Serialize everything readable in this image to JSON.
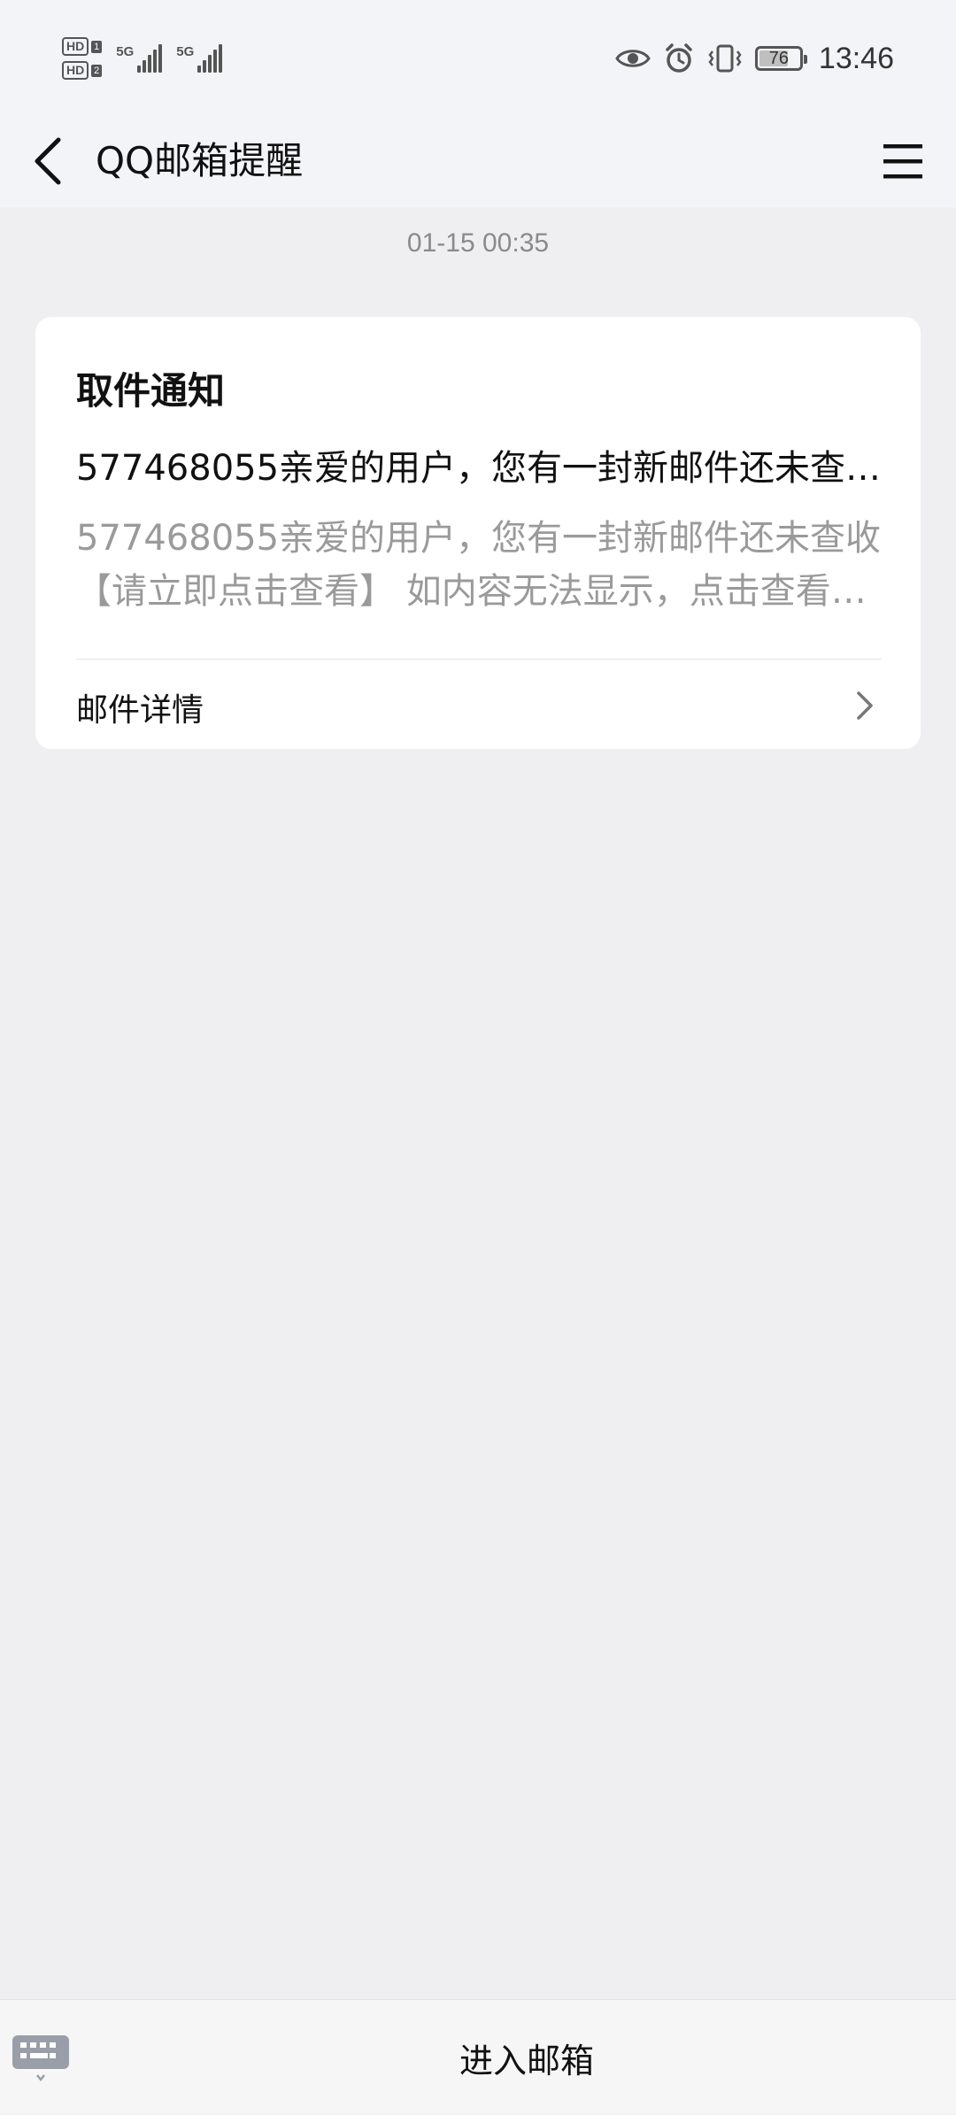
{
  "status_bar": {
    "sim1_label": "HD",
    "sim1_num": "1",
    "sim2_label": "HD",
    "sim2_num": "2",
    "network1": "5G",
    "network2": "5G",
    "battery_level": "76",
    "battery_percent": 76,
    "time": "13:46",
    "icons": [
      "eye-icon",
      "alarm-icon",
      "vibrate-icon",
      "battery-icon"
    ]
  },
  "header": {
    "title": "QQ邮箱提醒",
    "back_icon": "chevron-left-icon",
    "menu_icon": "hamburger-menu-icon"
  },
  "message": {
    "timestamp": "01-15 00:35",
    "card": {
      "title": "取件通知",
      "subject": "577468055亲爱的用户，您有一封新邮件还未查收【请立即点击查看】",
      "preview": "577468055亲爱的用户，您有一封新邮件还未查收【请立即点击查看】  如内容无法显示，点击查看详情",
      "detail_label": "邮件详情",
      "detail_icon": "chevron-right-icon"
    }
  },
  "bottom_bar": {
    "keyboard_icon": "keyboard-icon",
    "menu_label": "进入邮箱"
  }
}
